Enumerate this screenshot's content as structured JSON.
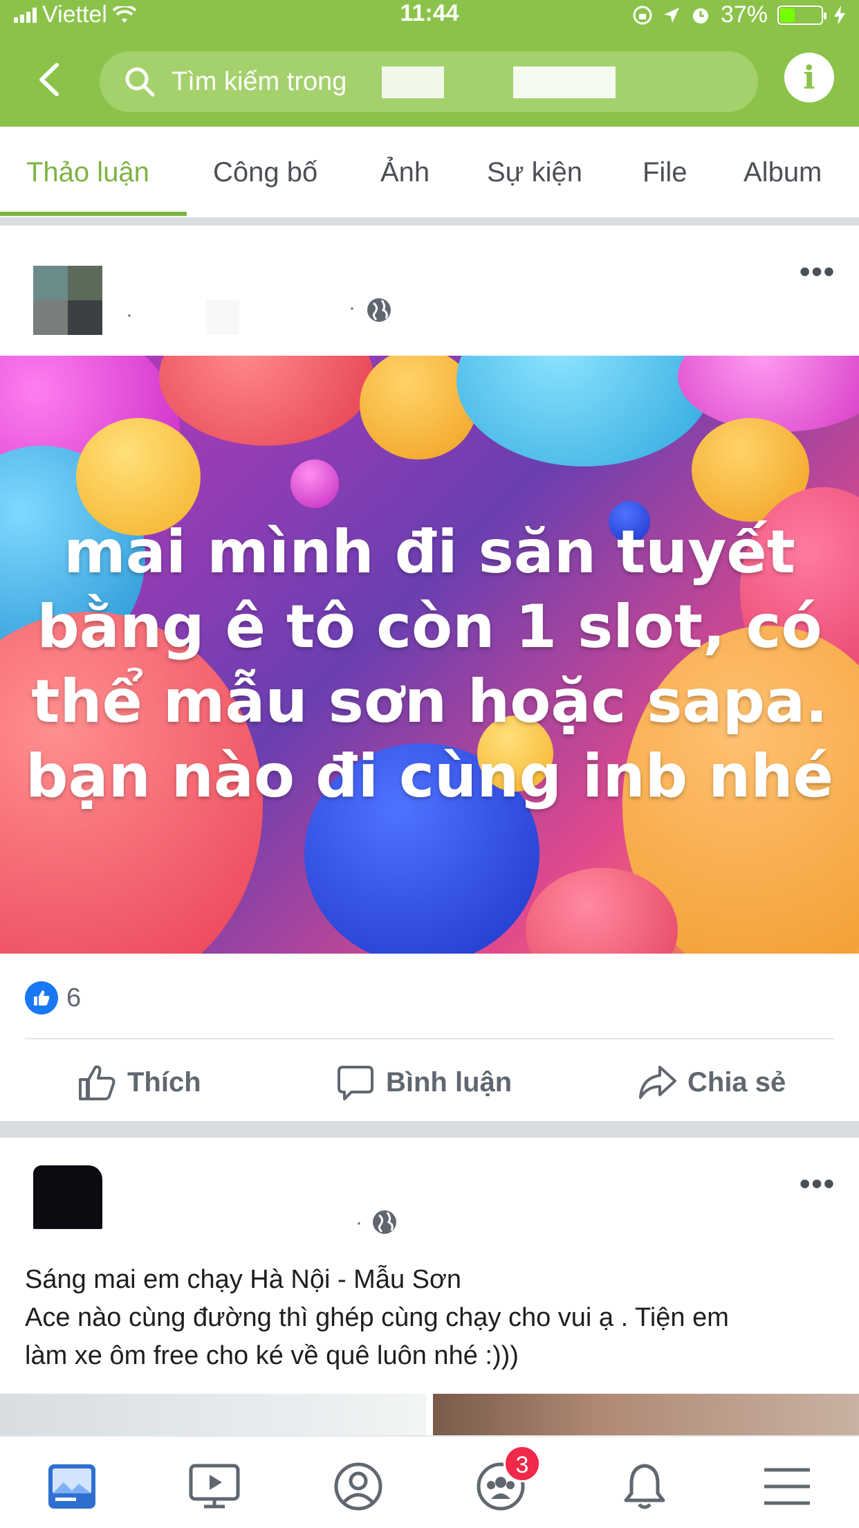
{
  "status_bar": {
    "carrier": "Viettel",
    "time": "11:44",
    "battery": "37%",
    "battery_level": 0.37
  },
  "header": {
    "search_placeholder": "Tìm kiếm trong"
  },
  "tabs": [
    {
      "label": "Thảo luận",
      "active": true
    },
    {
      "label": "Công bố",
      "active": false
    },
    {
      "label": "Ảnh",
      "active": false
    },
    {
      "label": "Sự kiện",
      "active": false
    },
    {
      "label": "File",
      "active": false
    },
    {
      "label": "Album",
      "active": false
    }
  ],
  "post1": {
    "banner_text": "mai mình đi săn tuyết bằng ê tô còn 1 slot, có thể mẫu sơn hoặc sapa. bạn nào đi cùng inb nhé",
    "banner_lines": [
      "mai mình đi săn tuyết",
      "bằng ê tô còn 1 slot, có",
      "thể mẫu sơn hoặc sapa.",
      "bạn nào đi cùng inb nhé"
    ],
    "like_count": "6",
    "actions": {
      "like": "Thích",
      "comment": "Bình luận",
      "share": "Chia sẻ"
    }
  },
  "post2": {
    "lines": [
      "Sáng mai em chạy Hà Nội - Mẫu Sơn",
      "Ace nào cùng đường thì ghép cùng chạy cho vui ạ . Tiện em",
      "làm xe ôm free cho ké về quê luôn nhé :)))"
    ]
  },
  "bottom_nav": {
    "groups_badge": "3"
  },
  "colors": {
    "brand_green": "#8bc34a",
    "active_tab": "#7cb342",
    "like_blue": "#1877f2",
    "badge_red": "#f02849"
  }
}
